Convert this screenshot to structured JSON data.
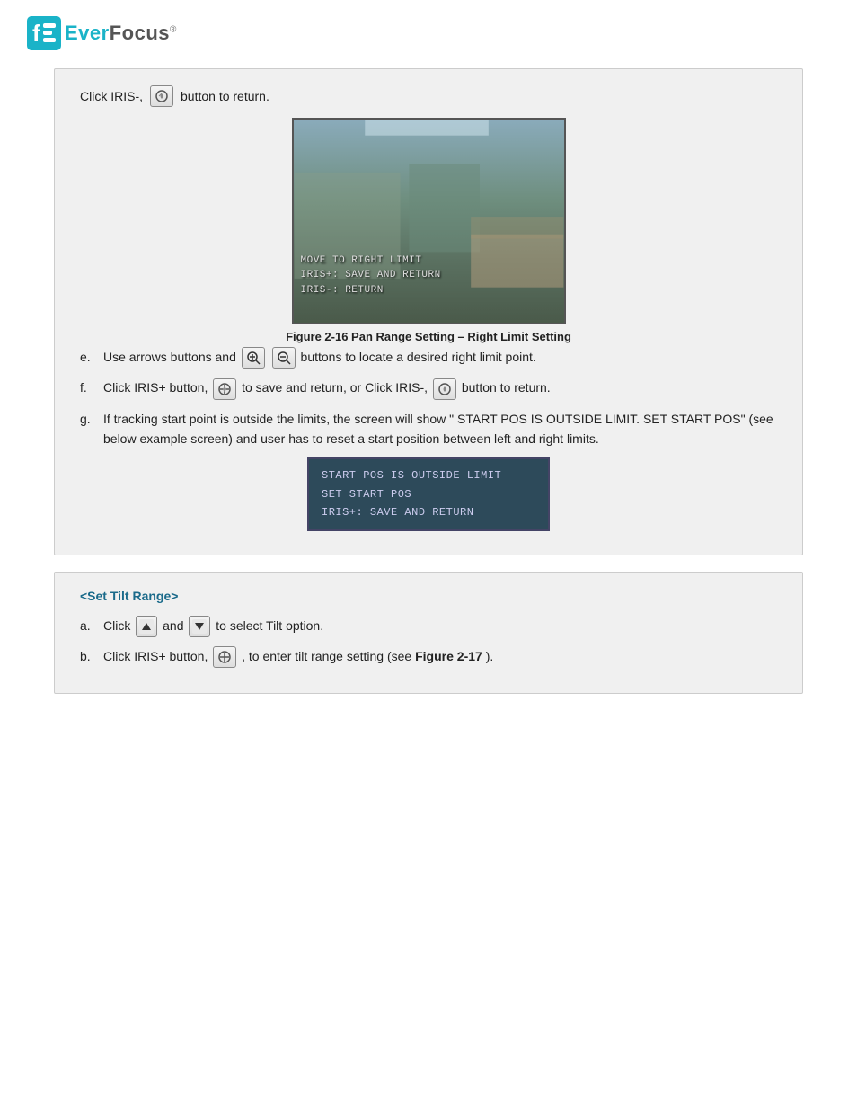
{
  "header": {
    "logo_alt": "EverFocus Logo",
    "logo_ever": "Ever",
    "logo_focus": "Focus",
    "logo_reg": "®"
  },
  "section1": {
    "intro_text_before": "Click IRIS-,",
    "intro_text_after": "button to return.",
    "figure_caption": "Figure 2-16 Pan Range Setting – Right Limit Setting",
    "cam_osd_lines": [
      "MOVE TO RIGHT LIMIT",
      "IRIS+: SAVE AND RETURN",
      "IRIS-: RETURN"
    ],
    "items": [
      {
        "label": "e.",
        "text_before": "Use arrows buttons and",
        "text_after": "buttons to locate a desired right limit point."
      },
      {
        "label": "f.",
        "text_before": "Click IRIS+ button,",
        "text_middle": "to save and return, or Click IRIS-,",
        "text_after": "button to return."
      },
      {
        "label": "g.",
        "text": "If tracking start point is outside the limits, the screen will show \" START POS IS OUTSIDE LIMIT. SET START POS\" (see below example screen) and user has to reset a start position between left and right limits."
      }
    ],
    "osd_lines": [
      "START POS IS OUTSIDE LIMIT",
      "SET START POS",
      "IRIS+: SAVE AND RETURN"
    ]
  },
  "section2": {
    "title": "<Set Tilt Range>",
    "items": [
      {
        "label": "a.",
        "text_before": "Click",
        "text_after": "and",
        "text_end": "to select Tilt option."
      },
      {
        "label": "b.",
        "text_before": "Click IRIS+ button,",
        "text_after": ", to enter tilt range setting (see",
        "bold_text": "Figure 2-17",
        "text_end": ")."
      }
    ]
  }
}
